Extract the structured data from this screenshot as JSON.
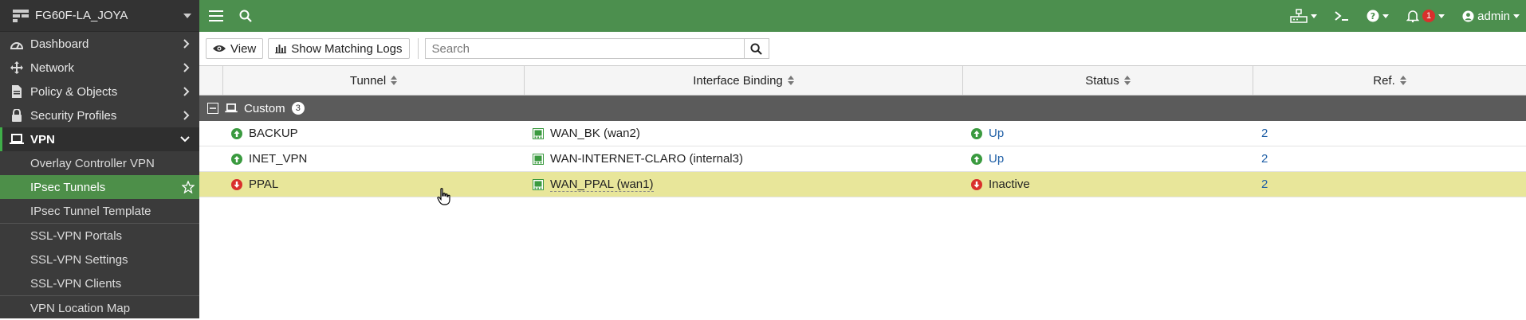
{
  "device": {
    "name": "FG60F-LA_JOYA"
  },
  "sidebar": {
    "items": [
      {
        "label": "Dashboard",
        "icon": "dashboard-icon"
      },
      {
        "label": "Network",
        "icon": "network-icon"
      },
      {
        "label": "Policy & Objects",
        "icon": "policy-icon"
      },
      {
        "label": "Security Profiles",
        "icon": "lock-icon"
      },
      {
        "label": "VPN",
        "icon": "laptop-icon"
      }
    ],
    "vpn_sub": [
      {
        "label": "Overlay Controller VPN"
      },
      {
        "label": "IPsec Tunnels"
      },
      {
        "label": "IPsec Tunnel Template"
      },
      {
        "label": "SSL-VPN Portals"
      },
      {
        "label": "SSL-VPN Settings"
      },
      {
        "label": "SSL-VPN Clients"
      },
      {
        "label": "VPN Location Map"
      }
    ]
  },
  "topbar": {
    "admin_label": "admin",
    "notification_count": "1"
  },
  "toolbar": {
    "view_label": "View",
    "logs_label": "Show Matching Logs",
    "search_placeholder": "Search"
  },
  "table": {
    "columns": [
      "Tunnel",
      "Interface Binding",
      "Status",
      "Ref."
    ],
    "group": {
      "name": "Custom",
      "count": "3"
    },
    "rows": [
      {
        "tunnel": "BACKUP",
        "interface": "WAN_BK (wan2)",
        "status": "Up",
        "ref": "2"
      },
      {
        "tunnel": "INET_VPN",
        "interface": "WAN-INTERNET-CLARO (internal3)",
        "status": "Up",
        "ref": "2"
      },
      {
        "tunnel": "PPAL",
        "interface": "WAN_PPAL (wan1)",
        "status": "Inactive",
        "ref": "2"
      }
    ]
  },
  "colors": {
    "accent": "#4c8f4e",
    "up": "#3a9a3f",
    "down": "#d9302c",
    "selected_row": "#e8e69a"
  }
}
